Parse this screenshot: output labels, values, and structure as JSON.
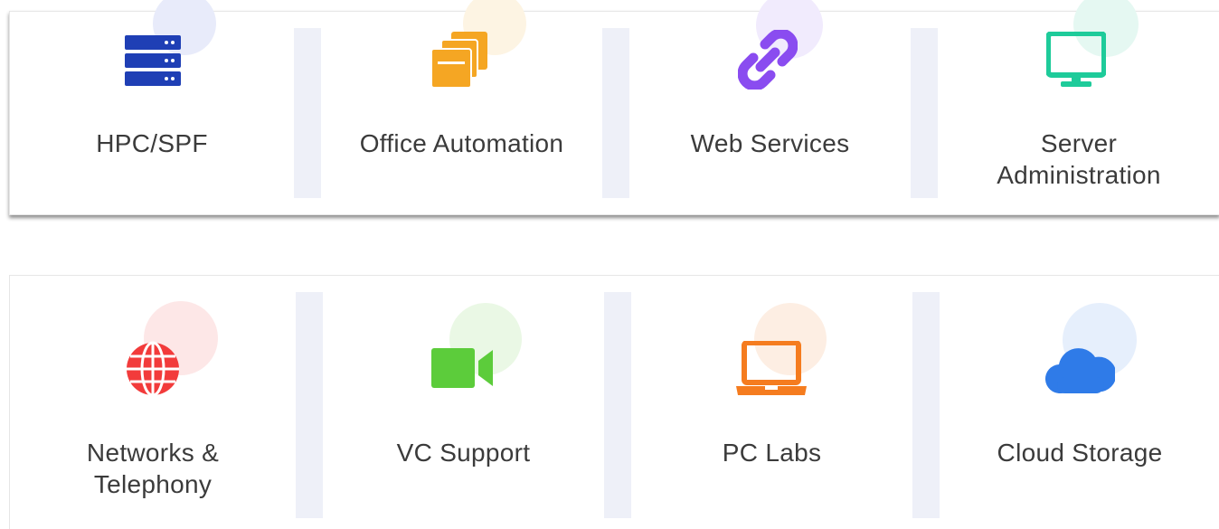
{
  "services": {
    "row1": [
      {
        "label": "HPC/SPF",
        "icon": "server-stack-icon",
        "color": "#1f3fb5",
        "circle": "#e8ebfa"
      },
      {
        "label": "Office Automation",
        "icon": "folders-icon",
        "color": "#f5a623",
        "circle": "#fdf4e3"
      },
      {
        "label": "Web Services",
        "icon": "link-icon",
        "color": "#8a4cf0",
        "circle": "#f1ebfd"
      },
      {
        "label_line1": "Server",
        "label_line2": "Administration",
        "icon": "monitor-icon",
        "color": "#1ecb9a",
        "circle": "#e5f8f2"
      }
    ],
    "row2": [
      {
        "label_line1": "Networks &",
        "label_line2": "Telephony",
        "icon": "globe-icon",
        "color": "#f23b3b",
        "circle": "#fde7e7"
      },
      {
        "label": "VC Support",
        "icon": "video-camera-icon",
        "color": "#5ccc3b",
        "circle": "#eaf8e5"
      },
      {
        "label": "PC Labs",
        "icon": "laptop-icon",
        "color": "#f57c1f",
        "circle": "#fdeee3"
      },
      {
        "label": "Cloud Storage",
        "icon": "cloud-icon",
        "color": "#2f7be8",
        "circle": "#e6effc"
      }
    ]
  }
}
